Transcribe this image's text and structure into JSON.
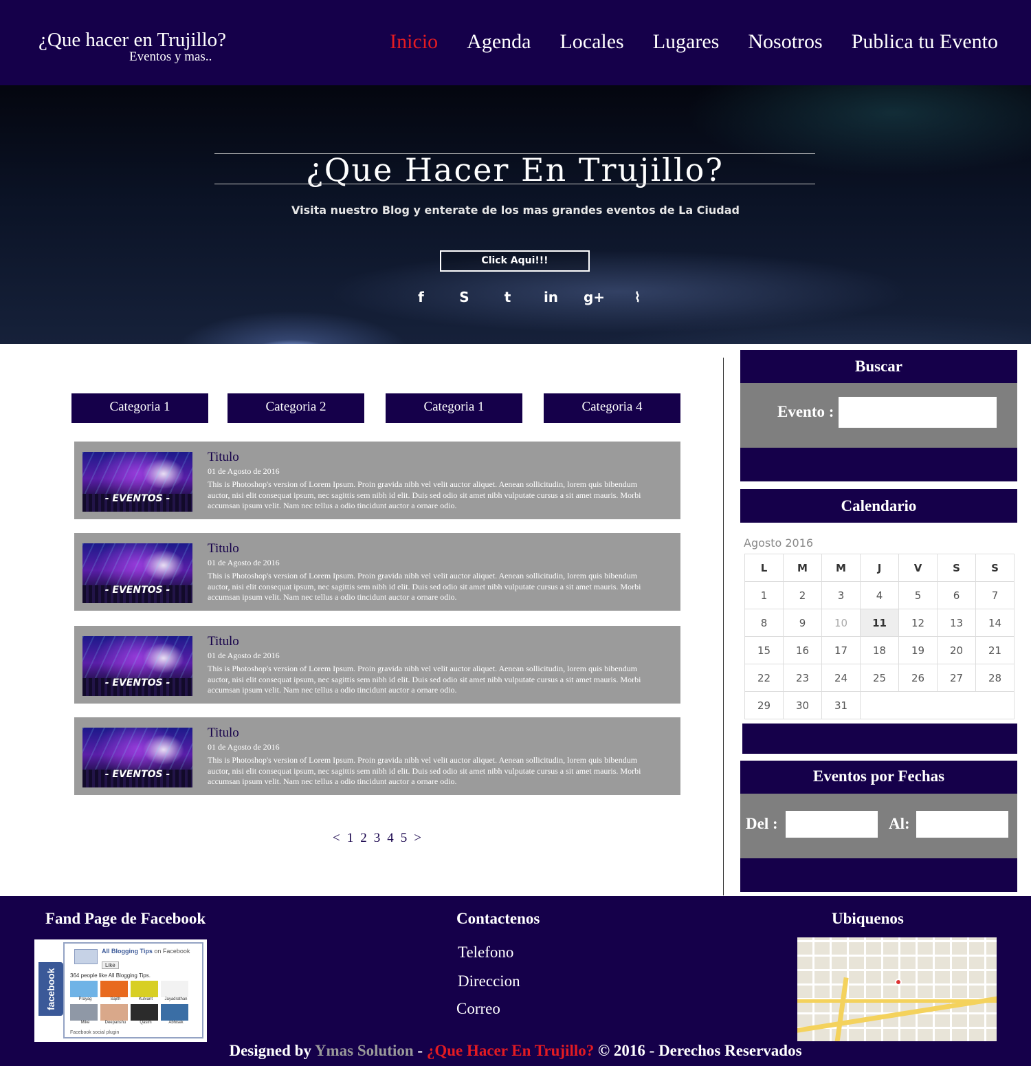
{
  "colors": {
    "primary": "#15004a",
    "accent": "#e31b22",
    "panel_gray": "#7f7f7f",
    "post_gray": "#9b9b9b"
  },
  "header": {
    "title": "¿Que hacer en Trujillo?",
    "subtitle": "Eventos y mas..",
    "nav": [
      "Inicio",
      "Agenda",
      "Locales",
      "Lugares",
      "Nosotros",
      "Publica tu Evento"
    ],
    "active_nav": "Inicio"
  },
  "hero": {
    "title": "¿Que Hacer En Trujillo?",
    "subtitle": "Visita nuestro Blog y enterate de los mas grandes eventos de La Ciudad",
    "button": "Click Aqui!!!",
    "social_icons": [
      "facebook-icon",
      "skype-icon",
      "twitter-icon",
      "linkedin-icon",
      "google-plus-icon",
      "rss-icon"
    ]
  },
  "categories": [
    "Categoria 1",
    "Categoria 2",
    "Categoria 1",
    "Categoria 4"
  ],
  "posts": [
    {
      "image_label": "- EVENTOS -",
      "title": "Titulo",
      "date": "01 de Agosto de 2016",
      "text": "This is Photoshop's version  of Lorem Ipsum. Proin gravida nibh vel velit auctor aliquet. Aenean sollicitudin, lorem quis bibendum auctor, nisi elit consequat ipsum, nec sagittis sem nibh id elit. Duis sed odio sit amet nibh vulputate cursus a sit amet mauris. Morbi accumsan ipsum velit. Nam nec tellus a odio tincidunt auctor a ornare odio."
    },
    {
      "image_label": "- EVENTOS -",
      "title": "Titulo",
      "date": "01 de Agosto de 2016",
      "text": "This is Photoshop's version  of Lorem Ipsum. Proin gravida nibh vel velit auctor aliquet. Aenean sollicitudin, lorem quis bibendum auctor, nisi elit consequat ipsum, nec sagittis sem nibh id elit. Duis sed odio sit amet nibh vulputate cursus a sit amet mauris. Morbi accumsan ipsum velit. Nam nec tellus a odio tincidunt auctor a ornare odio."
    },
    {
      "image_label": "- EVENTOS -",
      "title": "Titulo",
      "date": "01 de Agosto de 2016",
      "text": "This is Photoshop's version  of Lorem Ipsum. Proin gravida nibh vel velit auctor aliquet. Aenean sollicitudin, lorem quis bibendum auctor, nisi elit consequat ipsum, nec sagittis sem nibh id elit. Duis sed odio sit amet nibh vulputate cursus a sit amet mauris. Morbi accumsan ipsum velit. Nam nec tellus a odio tincidunt auctor a ornare odio."
    },
    {
      "image_label": "- EVENTOS -",
      "title": "Titulo",
      "date": "01 de Agosto de 2016",
      "text": "This is Photoshop's version  of Lorem Ipsum. Proin gravida nibh vel velit auctor aliquet. Aenean sollicitudin, lorem quis bibendum auctor, nisi elit consequat ipsum, nec sagittis sem nibh id elit. Duis sed odio sit amet nibh vulputate cursus a sit amet mauris. Morbi accumsan ipsum velit. Nam nec tellus a odio tincidunt auctor a ornare odio."
    }
  ],
  "pagination": {
    "prev": "<",
    "pages": [
      "1",
      "2",
      "3",
      "4",
      "5"
    ],
    "next": ">"
  },
  "sidebar": {
    "search": {
      "title": "Buscar",
      "label": "Evento :",
      "value": ""
    },
    "calendar": {
      "title": "Calendario",
      "month": "Agosto 2016",
      "weekdays": [
        "L",
        "M",
        "M",
        "J",
        "V",
        "S",
        "S"
      ],
      "weeks": [
        [
          "1",
          "2",
          "3",
          "4",
          "5",
          "6",
          "7"
        ],
        [
          "8",
          "9",
          "10",
          "11",
          "12",
          "13",
          "14"
        ],
        [
          "15",
          "16",
          "17",
          "18",
          "19",
          "20",
          "21"
        ],
        [
          "22",
          "23",
          "24",
          "25",
          "26",
          "27",
          "28"
        ],
        [
          "29",
          "30",
          "31",
          "",
          "",
          "",
          ""
        ]
      ],
      "highlighted_day": "11",
      "muted_day": "10"
    },
    "dates": {
      "title": "Eventos por Fechas",
      "from_label": "Del :",
      "to_label": "Al:",
      "from_value": "",
      "to_value": ""
    }
  },
  "footer": {
    "facebook": {
      "title": "Fand Page de Facebook",
      "side_label": "facebook",
      "page_name": "All Blogging Tips",
      "page_name_suffix": "on Facebook",
      "like_button": "Like",
      "fans_text": "364 people like All Blogging Tips.",
      "fans": [
        "Prayag",
        "Sajith",
        "Kulvant",
        "Jayadrathan",
        "Mike",
        "Deepanshu",
        "Qasim",
        "Abhisek"
      ],
      "plugin_label": "Facebook social plugin"
    },
    "contact": {
      "title": "Contactenos",
      "items": [
        "Telefono",
        "Direccion",
        "Correo"
      ]
    },
    "location": {
      "title": "Ubiquenos"
    },
    "credit": {
      "prefix": "Designed by ",
      "company": "Ymas Solution",
      "separator": " - ",
      "site": "¿Que Hacer En Trujillo?",
      "suffix": " © 2016 - Derechos Reservados"
    }
  }
}
